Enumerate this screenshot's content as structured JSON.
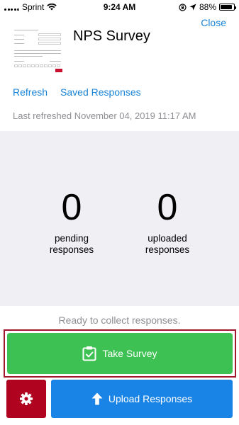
{
  "status_bar": {
    "carrier": "Sprint",
    "time": "9:24 AM",
    "battery": "88%",
    "battery_level": 0.88
  },
  "header": {
    "title": "NPS Survey",
    "close_label": "Close"
  },
  "links": {
    "refresh": "Refresh",
    "saved_responses": "Saved Responses"
  },
  "last_refreshed": "Last refreshed November 04, 2019 11:17 AM",
  "stats": {
    "pending": {
      "count": "0",
      "label": "pending\nresponses"
    },
    "uploaded": {
      "count": "0",
      "label": "uploaded\nresponses"
    }
  },
  "ready_text": "Ready to collect responses.",
  "buttons": {
    "take_survey": "Take Survey",
    "upload_responses": "Upload Responses"
  },
  "colors": {
    "link_blue": "#1a84d8",
    "take_green": "#3cc152",
    "upload_blue": "#1a84e6",
    "settings_red": "#b0031f",
    "highlight_border": "#a0172c"
  }
}
